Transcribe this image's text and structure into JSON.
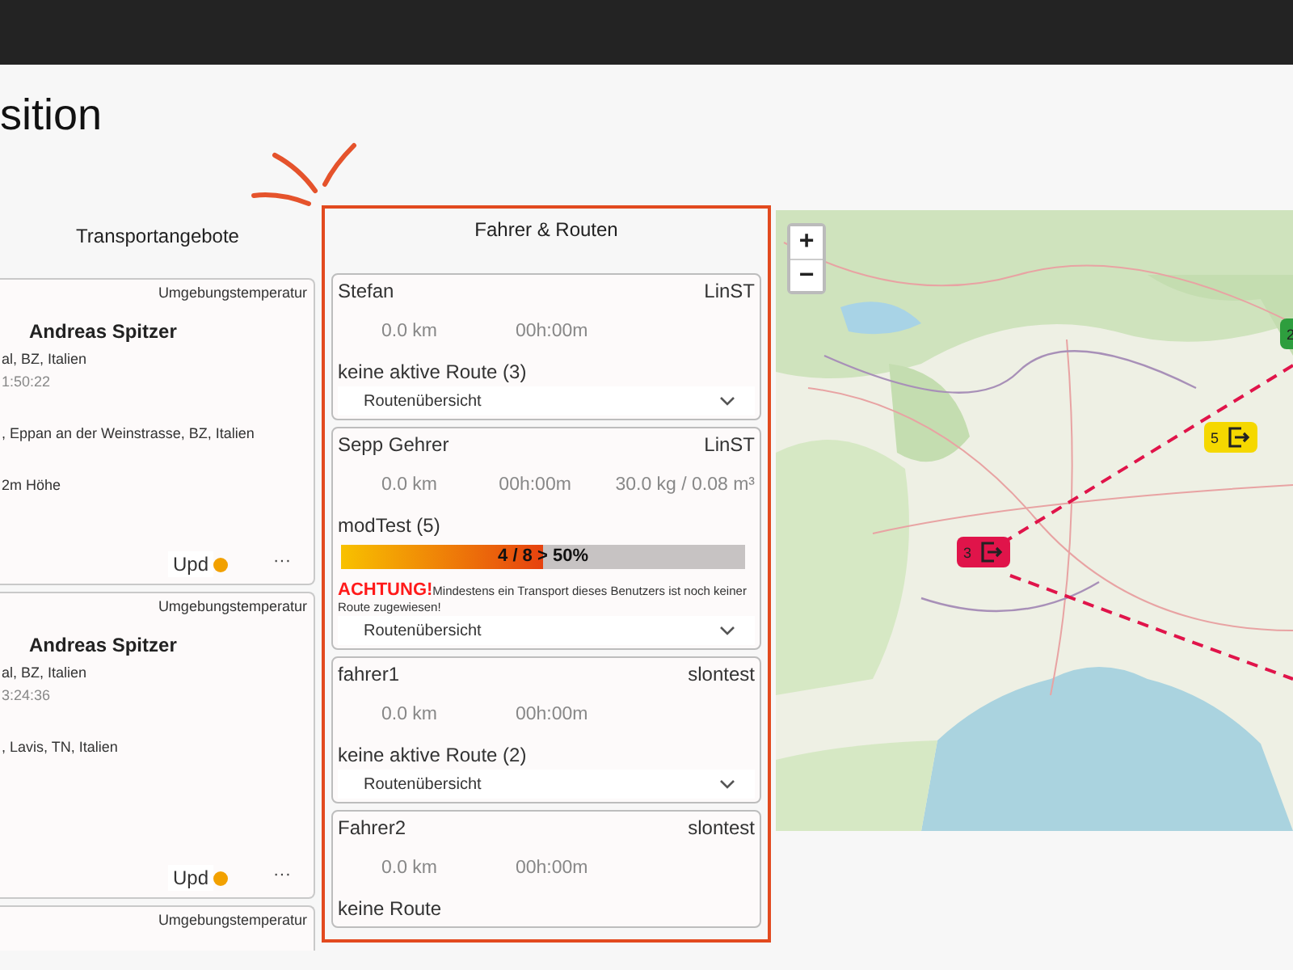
{
  "page_title": "sition",
  "offers": {
    "heading": "Transportangebote",
    "cards": [
      {
        "tag": "Umgebungstemperatur",
        "name": "Andreas Spitzer",
        "place": "al, BZ, Italien",
        "time": "1:50:22",
        "address": ", Eppan an der Weinstrasse, BZ, Italien",
        "note": "2m Höhe",
        "update": "Upd",
        "more": "···"
      },
      {
        "tag": "Umgebungstemperatur",
        "name": "Andreas Spitzer",
        "place": "al, BZ, Italien",
        "time": "3:24:36",
        "address": ", Lavis, TN, Italien",
        "update": "Upd",
        "more": "···"
      },
      {
        "tag": "Umgebungstemperatur"
      }
    ]
  },
  "drivers": {
    "heading": "Fahrer & Routen",
    "cards": [
      {
        "name": "Stefan",
        "company": "LinST",
        "distance": "0.0 km",
        "duration": "00h:00m",
        "route": "keine aktive Route (3)",
        "dropdown": "Routenübersicht"
      },
      {
        "name": "Sepp Gehrer",
        "company": "LinST",
        "distance": "0.0 km",
        "duration": "00h:00m",
        "load": "30.0 kg / 0.08 m³",
        "route": "modTest (5)",
        "progress": {
          "level": 0.5,
          "label": "4 / 8 > 50%"
        },
        "warning": {
          "alert": "ACHTUNG!",
          "text": "Mindestens ein Transport dieses Benutzers ist noch keiner Route zugewiesen!"
        },
        "dropdown": "Routenübersicht"
      },
      {
        "name": "fahrer1",
        "company": "slontest",
        "distance": "0.0 km",
        "duration": "00h:00m",
        "route": "keine aktive Route (2)",
        "dropdown": "Routenübersicht"
      },
      {
        "name": "Fahrer2",
        "company": "slontest",
        "distance": "0.0 km",
        "duration": "00h:00m",
        "route": "keine Route"
      }
    ]
  },
  "map": {
    "zoom_in": "+",
    "zoom_out": "−",
    "markers": [
      {
        "label": "3",
        "color": "#e0144a",
        "icon": true
      },
      {
        "label": "5",
        "color": "#f5d800",
        "icon": true
      },
      {
        "label": "2",
        "color": "#2e9e3e",
        "icon": false
      }
    ]
  }
}
